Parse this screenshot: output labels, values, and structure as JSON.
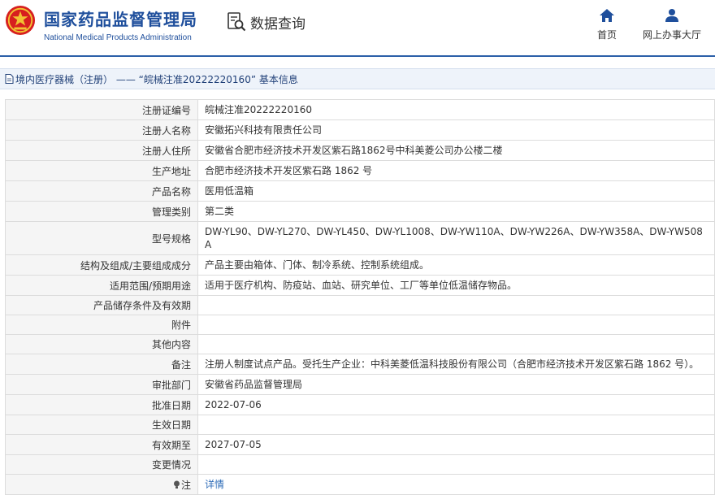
{
  "header": {
    "brand_cn": "国家药品监督管理局",
    "brand_en": "National Medical Products Administration",
    "query_label": "数据查询",
    "nav": [
      {
        "label": "首页",
        "icon": "home-icon"
      },
      {
        "label": "网上办事大厅",
        "icon": "user-icon"
      }
    ]
  },
  "breadcrumb": "境内医疗器械（注册） —— “皖械注准20222220160” 基本信息",
  "rows": [
    {
      "label": "注册证编号",
      "value": "皖械注准20222220160"
    },
    {
      "label": "注册人名称",
      "value": "安徽拓兴科技有限责任公司"
    },
    {
      "label": "注册人住所",
      "value": "安徽省合肥市经济技术开发区紫石路1862号中科美菱公司办公楼二楼"
    },
    {
      "label": "生产地址",
      "value": "合肥市经济技术开发区紫石路 1862 号"
    },
    {
      "label": "产品名称",
      "value": "医用低温箱"
    },
    {
      "label": "管理类别",
      "value": "第二类"
    },
    {
      "label": "型号规格",
      "value": "DW-YL90、DW-YL270、DW-YL450、DW-YL1008、DW-YW110A、DW-YW226A、DW-YW358A、DW-YW508A"
    },
    {
      "label": "结构及组成/主要组成成分",
      "value": "产品主要由箱体、门体、制冷系统、控制系统组成。"
    },
    {
      "label": "适用范围/预期用途",
      "value": "适用于医疗机构、防疫站、血站、研究单位、工厂等单位低温储存物品。"
    },
    {
      "label": "产品储存条件及有效期",
      "value": ""
    },
    {
      "label": "附件",
      "value": ""
    },
    {
      "label": "其他内容",
      "value": ""
    },
    {
      "label": "备注",
      "value": "注册人制度试点产品。受托生产企业：中科美菱低温科技股份有限公司（合肥市经济技术开发区紫石路 1862 号）。"
    },
    {
      "label": "审批部门",
      "value": "安徽省药品监督管理局"
    },
    {
      "label": "批准日期",
      "value": "2022-07-06"
    },
    {
      "label": "生效日期",
      "value": ""
    },
    {
      "label": "有效期至",
      "value": "2027-07-05"
    },
    {
      "label": "变更情况",
      "value": ""
    }
  ],
  "note_row": {
    "label": "注",
    "link": "详情"
  },
  "colors": {
    "brand": "#1f4f9c",
    "link": "#2f6db8",
    "emblem_red": "#d71f1f",
    "emblem_gold": "#f2c233"
  }
}
